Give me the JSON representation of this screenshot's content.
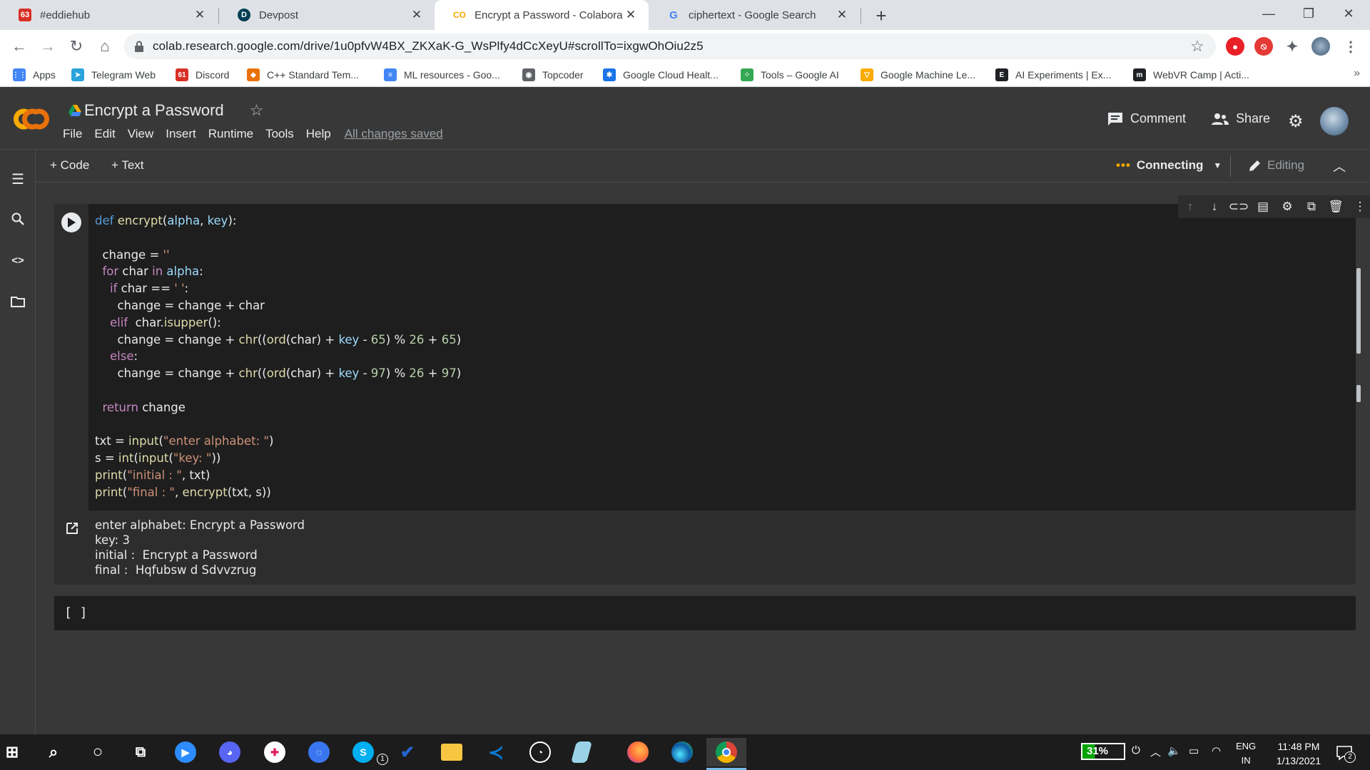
{
  "browser": {
    "tabs": [
      {
        "title": "#eddiehub",
        "favicon": "slack-icon",
        "badge": "63"
      },
      {
        "title": "Devpost",
        "favicon": "devpost-icon",
        "badge": "D"
      },
      {
        "title": "Encrypt a Password - Colaborato",
        "favicon": "colab-icon",
        "badge": "CO"
      },
      {
        "title": "ciphertext - Google Search",
        "favicon": "google-icon",
        "badge": "G"
      }
    ],
    "url": "colab.research.google.com/drive/1u0pfvW4BX_ZKXaK-G_WsPlfy4dCcXeyU#scrollTo=ixgwOhOiu2z5",
    "bookmarks": [
      {
        "label": "Apps",
        "icon": "apps-grid-icon",
        "color": "#4285f4",
        "glyph": "⋮⋮"
      },
      {
        "label": "Telegram Web",
        "icon": "telegram-icon",
        "color": "#2aa3dc",
        "glyph": "➤"
      },
      {
        "label": "Discord",
        "icon": "discord-icon",
        "color": "#d93025",
        "glyph": "61"
      },
      {
        "label": "C++ Standard Tem...",
        "icon": "cpp-icon",
        "color": "#e8710a",
        "glyph": "◆"
      },
      {
        "label": "ML resources - Goo...",
        "icon": "docs-icon",
        "color": "#4285f4",
        "glyph": "≡"
      },
      {
        "label": "Topcoder",
        "icon": "topcoder-icon",
        "color": "#5f6368",
        "glyph": "◉"
      },
      {
        "label": "Google Cloud Healt...",
        "icon": "gcloud-icon",
        "color": "#1a73e8",
        "glyph": "✱"
      },
      {
        "label": "Tools – Google AI",
        "icon": "google-ai-icon",
        "color": "#34a853",
        "glyph": "⁘"
      },
      {
        "label": "Google Machine Le...",
        "icon": "google-ml-icon",
        "color": "#f9ab00",
        "glyph": "▽"
      },
      {
        "label": "AI Experiments | Ex...",
        "icon": "ai-experiments-icon",
        "color": "#202124",
        "glyph": "E"
      },
      {
        "label": "WebVR Camp | Acti...",
        "icon": "webvr-icon",
        "color": "#202124",
        "glyph": "m"
      }
    ],
    "more": "»"
  },
  "colab": {
    "title": "Encrypt a Password",
    "menu": [
      "File",
      "Edit",
      "View",
      "Insert",
      "Runtime",
      "Tools",
      "Help"
    ],
    "saved_status": "All changes saved",
    "comment_label": "Comment",
    "share_label": "Share",
    "add_code_label": "+ Code",
    "add_text_label": "+ Text",
    "runtime_status": "Connecting",
    "mode_label": "Editing"
  },
  "cell": {
    "code_lines": [
      "def encrypt(alpha, key):",
      "",
      "  change = ''",
      "  for char in alpha:",
      "    if char == ' ':",
      "      change = change + char",
      "    elif  char.isupper():",
      "      change = change + chr((ord(char) + key - 65) % 26 + 65)",
      "    else:",
      "      change = change + chr((ord(char) + key - 97) % 26 + 97)",
      "",
      "  return change",
      "",
      "txt = input(\"enter alphabet: \")",
      "s = int(input(\"key: \"))",
      "print(\"initial : \", txt)",
      "print(\"final : \", encrypt(txt, s))"
    ],
    "output_lines": [
      "enter alphabet: Encrypt a Password",
      "key: 3",
      "initial :  Encrypt a Password",
      "final :  Hqfubsw d Sdvvzrug"
    ],
    "empty_cell_label": "[ ]"
  },
  "taskbar": {
    "apps": [
      "windows-start-icon",
      "search-icon",
      "cortana-icon",
      "task-view-icon",
      "zoom-icon",
      "discord-icon",
      "slack-icon",
      "signal-icon",
      "skype-icon",
      "todo-icon",
      "file-explorer-icon",
      "vscode-icon",
      "obs-icon",
      "notes-icon",
      "firefox-icon",
      "edge-icon",
      "chrome-icon"
    ],
    "skype_badge": "1",
    "battery": "31%",
    "language_top": "ENG",
    "language_bottom": "IN",
    "time": "11:48 PM",
    "date": "1/13/2021",
    "notification_count": "2"
  }
}
